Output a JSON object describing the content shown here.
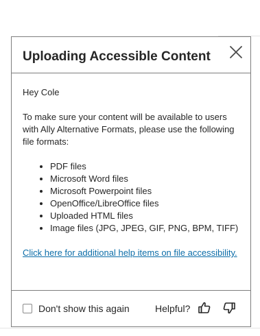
{
  "dialog": {
    "title": "Uploading Accessible Content",
    "close_icon": "close-icon",
    "greeting": "Hey Cole",
    "intro": "To make sure your content will be available to users with Ally Alternative Formats, please use the following file formats:",
    "formats": [
      "PDF files",
      "Microsoft Word files",
      "Microsoft Powerpoint files",
      "OpenOffice/LibreOffice files",
      "Uploaded HTML files",
      "Image files (JPG, JPEG, GIF, PNG, BPM, TIFF)"
    ],
    "help_link": "Click here for additional help items on file accessibility."
  },
  "footer": {
    "dont_show_label": "Don't show this again",
    "dont_show_checked": false,
    "helpful_label": "Helpful?",
    "thumbs_up_icon": "thumbs-up-icon",
    "thumbs_down_icon": "thumbs-down-icon"
  },
  "colors": {
    "link": "#0c6da8",
    "border": "#7d7d7d",
    "text": "#262626"
  }
}
